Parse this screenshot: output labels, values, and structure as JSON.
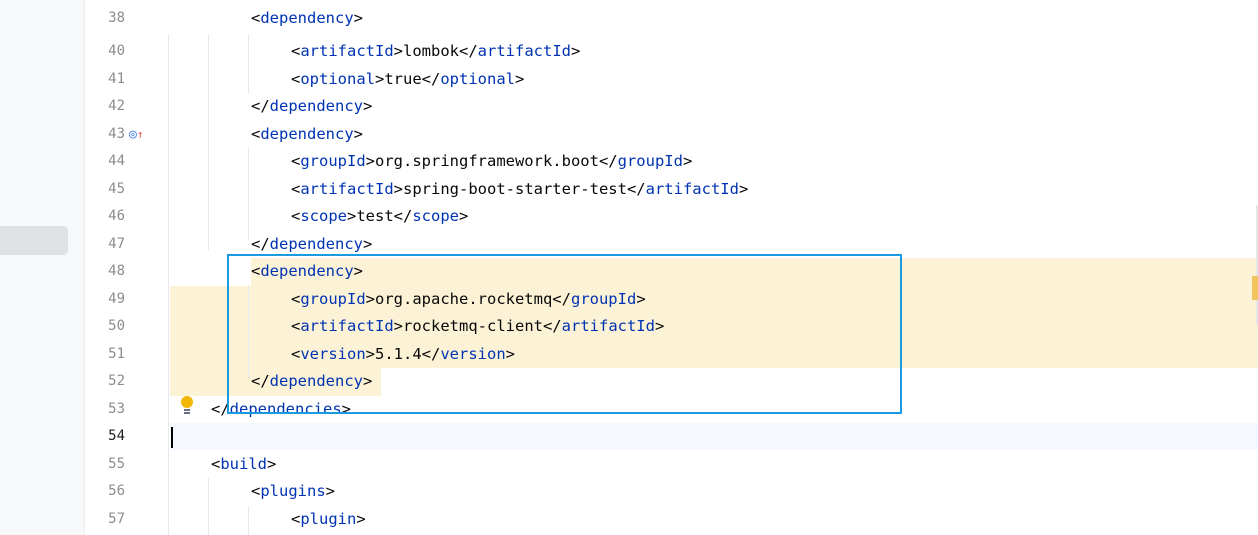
{
  "gutter": {
    "breakpoint_icon": "◎",
    "override_arrow": "↑"
  },
  "lines": [
    {
      "num": "38",
      "indent": 2,
      "parts": [
        {
          "t": "<",
          "c": "txt"
        },
        {
          "t": "dependency",
          "c": "tag"
        },
        {
          "t": ">",
          "c": "txt"
        }
      ]
    },
    {
      "num": "40",
      "indent": 3,
      "parts": [
        {
          "t": "<",
          "c": "txt"
        },
        {
          "t": "artifactId",
          "c": "tag"
        },
        {
          "t": ">lombok</",
          "c": "txt"
        },
        {
          "t": "artifactId",
          "c": "tag"
        },
        {
          "t": ">",
          "c": "txt"
        }
      ]
    },
    {
      "num": "41",
      "indent": 3,
      "parts": [
        {
          "t": "<",
          "c": "txt"
        },
        {
          "t": "optional",
          "c": "tag"
        },
        {
          "t": ">true</",
          "c": "txt"
        },
        {
          "t": "optional",
          "c": "tag"
        },
        {
          "t": ">",
          "c": "txt"
        }
      ]
    },
    {
      "num": "42",
      "indent": 2,
      "parts": [
        {
          "t": "</",
          "c": "txt"
        },
        {
          "t": "dependency",
          "c": "tag"
        },
        {
          "t": ">",
          "c": "txt"
        }
      ]
    },
    {
      "num": "43",
      "indent": 2,
      "parts": [
        {
          "t": "<",
          "c": "txt"
        },
        {
          "t": "dependency",
          "c": "tag"
        },
        {
          "t": ">",
          "c": "txt"
        }
      ]
    },
    {
      "num": "44",
      "indent": 3,
      "parts": [
        {
          "t": "<",
          "c": "txt"
        },
        {
          "t": "groupId",
          "c": "tag"
        },
        {
          "t": ">org.springframework.boot</",
          "c": "txt"
        },
        {
          "t": "groupId",
          "c": "tag"
        },
        {
          "t": ">",
          "c": "txt"
        }
      ]
    },
    {
      "num": "45",
      "indent": 3,
      "parts": [
        {
          "t": "<",
          "c": "txt"
        },
        {
          "t": "artifactId",
          "c": "tag"
        },
        {
          "t": ">spring-boot-starter-test</",
          "c": "txt"
        },
        {
          "t": "artifactId",
          "c": "tag"
        },
        {
          "t": ">",
          "c": "txt"
        }
      ]
    },
    {
      "num": "46",
      "indent": 3,
      "parts": [
        {
          "t": "<",
          "c": "txt"
        },
        {
          "t": "scope",
          "c": "tag"
        },
        {
          "t": ">test</",
          "c": "txt"
        },
        {
          "t": "scope",
          "c": "tag"
        },
        {
          "t": ">",
          "c": "txt"
        }
      ]
    },
    {
      "num": "47",
      "indent": 2,
      "parts": [
        {
          "t": "</",
          "c": "txt"
        },
        {
          "t": "dependency",
          "c": "tag"
        },
        {
          "t": ">",
          "c": "txt"
        }
      ]
    },
    {
      "num": "48",
      "indent": 2,
      "parts": [
        {
          "t": "<",
          "c": "txt"
        },
        {
          "t": "dependency",
          "c": "tag"
        },
        {
          "t": ">",
          "c": "txt"
        }
      ]
    },
    {
      "num": "49",
      "indent": 3,
      "parts": [
        {
          "t": "<",
          "c": "txt"
        },
        {
          "t": "groupId",
          "c": "tag"
        },
        {
          "t": ">org.apache.rocketmq</",
          "c": "txt"
        },
        {
          "t": "groupId",
          "c": "tag"
        },
        {
          "t": ">",
          "c": "txt"
        }
      ]
    },
    {
      "num": "50",
      "indent": 3,
      "parts": [
        {
          "t": "<",
          "c": "txt"
        },
        {
          "t": "artifactId",
          "c": "tag"
        },
        {
          "t": ">rocketmq-client</",
          "c": "txt"
        },
        {
          "t": "artifactId",
          "c": "tag"
        },
        {
          "t": ">",
          "c": "txt"
        }
      ]
    },
    {
      "num": "51",
      "indent": 3,
      "parts": [
        {
          "t": "<",
          "c": "txt"
        },
        {
          "t": "version",
          "c": "tag"
        },
        {
          "t": ">5.1.4</",
          "c": "txt"
        },
        {
          "t": "version",
          "c": "tag"
        },
        {
          "t": ">",
          "c": "txt"
        }
      ]
    },
    {
      "num": "52",
      "indent": 2,
      "parts": [
        {
          "t": "</",
          "c": "txt"
        },
        {
          "t": "dependency",
          "c": "tag"
        },
        {
          "t": ">",
          "c": "txt"
        }
      ]
    },
    {
      "num": "53",
      "indent": 1,
      "parts": [
        {
          "t": "</",
          "c": "txt"
        },
        {
          "t": "dependencies",
          "c": "tag"
        },
        {
          "t": ">",
          "c": "txt"
        }
      ]
    },
    {
      "num": "54",
      "indent": 0,
      "parts": []
    },
    {
      "num": "55",
      "indent": 1,
      "parts": [
        {
          "t": "<",
          "c": "txt"
        },
        {
          "t": "build",
          "c": "tag"
        },
        {
          "t": ">",
          "c": "txt"
        }
      ]
    },
    {
      "num": "56",
      "indent": 2,
      "parts": [
        {
          "t": "<",
          "c": "txt"
        },
        {
          "t": "plugins",
          "c": "tag"
        },
        {
          "t": ">",
          "c": "txt"
        }
      ]
    },
    {
      "num": "57",
      "indent": 3,
      "parts": [
        {
          "t": "<",
          "c": "txt"
        },
        {
          "t": "plugin",
          "c": "tag"
        },
        {
          "t": ">",
          "c": "txt"
        }
      ]
    }
  ]
}
